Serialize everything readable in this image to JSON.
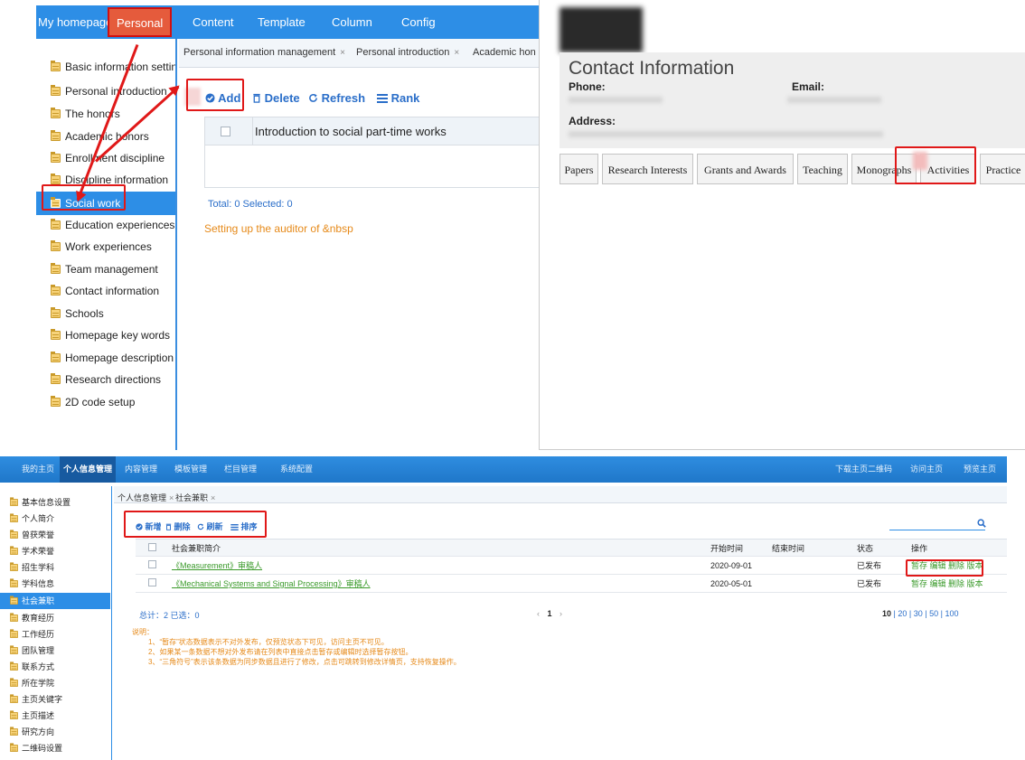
{
  "panel_en": {
    "topnav": [
      "My homepage",
      "Personal",
      "Content",
      "Template",
      "Column",
      "Config"
    ],
    "sidebar": [
      "Basic information settings",
      "Personal introduction",
      "The honors",
      "Academic honors",
      "Enrollment discipline",
      "Discipline information",
      "Social work",
      "Education experiences",
      "Work experiences",
      "Team management",
      "Contact information",
      "Schools",
      "Homepage key words",
      "Homepage description",
      "Research directions",
      "2D code setup"
    ],
    "tabs": [
      "Personal information management",
      "Personal introduction",
      "Academic hon"
    ],
    "tab_close": "×",
    "toolbar": {
      "add": "Add",
      "delete": "Delete",
      "refresh": "Refresh",
      "rank": "Rank"
    },
    "grid_header": "Introduction to social part-time works",
    "total": "Total: 0 Selected: 0",
    "auditor_note": "Setting up the auditor of &nbsp"
  },
  "panel_home": {
    "contact_title": "Contact Information",
    "phone_label": "Phone:",
    "email_label": "Email:",
    "address_label": "Address:",
    "tabs": [
      "Papers",
      "Research Interests",
      "Grants and Awards",
      "Teaching",
      "Monographs",
      "Activities",
      "Practice"
    ]
  },
  "panel_cn": {
    "topnav": [
      "我的主页",
      "个人信息管理",
      "内容管理",
      "模板管理",
      "栏目管理",
      "系统配置"
    ],
    "topnav_right": [
      "下载主页二维码",
      "访问主页",
      "预览主页"
    ],
    "sidebar": [
      "基本信息设置",
      "个人简介",
      "曾获荣誉",
      "学术荣誉",
      "招生学科",
      "学科信息",
      "社会兼职",
      "教育经历",
      "工作经历",
      "团队管理",
      "联系方式",
      "所在学院",
      "主页关键字",
      "主页描述",
      "研究方向",
      "二维码设置"
    ],
    "tabs": [
      "个人信息管理",
      "社会兼职"
    ],
    "toolbar": {
      "add": "新增",
      "delete": "删除",
      "refresh": "刷新",
      "sort": "排序"
    },
    "columns": [
      "社会兼职简介",
      "开始时间",
      "结束时间",
      "状态",
      "操作"
    ],
    "rows": [
      {
        "title": "《Measurement》审稿人",
        "start": "2020-09-01",
        "end": "",
        "status": "已发布",
        "ops": "暂存 编辑 删除 版本"
      },
      {
        "title": "《Mechanical Systems and Signal Processing》审稿人",
        "start": "2020-05-01",
        "end": "",
        "status": "已发布",
        "ops": "暂存 编辑 删除 版本"
      }
    ],
    "total": "总计：2 已选：0",
    "page_current": "1",
    "page_prev": "‹",
    "page_next": "›",
    "page_sizes": [
      "10",
      "20",
      "30",
      "50",
      "100"
    ],
    "notes": [
      "说明：",
      "1、“暂存”状态数据表示不对外发布，仅预览状态下可见，访问主页不可见。",
      "2、如果某一条数据不想对外发布请在列表中直接点击暂存或编辑时选择暂存按钮。",
      "3、“三角符号”表示该条数据为同步数据且进行了修改，点击可跳转到修改详情页，支持恢复操作。"
    ]
  },
  "colors": {
    "nav_blue": "#2d8ee6",
    "highlight_red": "#e01818",
    "note_orange": "#e68a1a",
    "link_green": "#3a9a2a"
  }
}
